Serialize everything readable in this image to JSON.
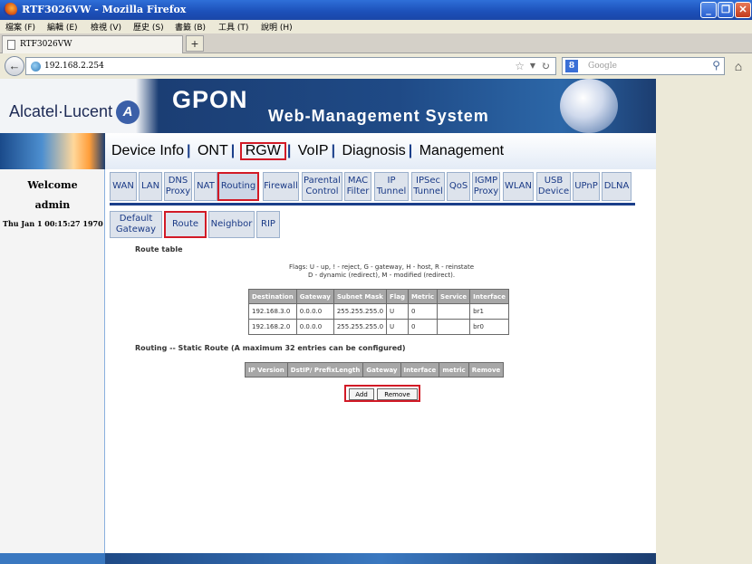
{
  "window": {
    "title": "RTF3026VW - Mozilla Firefox",
    "controls": [
      "_",
      "❐",
      "✕"
    ]
  },
  "menubar": [
    "檔案 (F)",
    "編輯 (E)",
    "檢視 (V)",
    "歷史 (S)",
    "書籤 (B)",
    "工具 (T)",
    "說明 (H)"
  ],
  "tabs": [
    {
      "label": "RTF3026VW"
    }
  ],
  "newtab": "+",
  "navbar": {
    "url": "192.168.2.254",
    "search_placeholder": "Google",
    "search_engine": "8"
  },
  "banner": {
    "brand": "Alcatel·Lucent",
    "brand_mark": "A",
    "product": "GPON",
    "subtitle": "Web-Management System"
  },
  "left": {
    "welcome": "Welcome",
    "user": "admin",
    "clock": "Thu Jan 1 00:15:27 1970"
  },
  "topnav": [
    "Device Info",
    "ONT",
    "RGW",
    "VoIP",
    "Diagnosis",
    "Management"
  ],
  "topnav_active": "RGW",
  "subnav": [
    "WAN",
    "LAN",
    "DNS Proxy",
    "NAT",
    "Routing",
    "Firewall",
    "Parental Control",
    "MAC Filter",
    "IP Tunnel",
    "IPSec Tunnel",
    "QoS",
    "IGMP Proxy",
    "WLAN",
    "USB Device",
    "UPnP",
    "DLNA"
  ],
  "subnav_active": "Routing",
  "routing_tabs": [
    "Default Gateway",
    "Route",
    "Neighbor",
    "RIP"
  ],
  "routing_active": "Route",
  "route_table": {
    "title": "Route table",
    "flags_line1": "Flags: U - up, ! - reject, G - gateway, H - host, R - reinstate",
    "flags_line2": "D - dynamic (redirect), M - modified (redirect).",
    "columns": [
      "Destination",
      "Gateway",
      "Subnet Mask",
      "Flag",
      "Metric",
      "Service",
      "Interface"
    ],
    "rows": [
      [
        "192.168.3.0",
        "0.0.0.0",
        "255.255.255.0",
        "U",
        "0",
        "",
        "br1"
      ],
      [
        "192.168.2.0",
        "0.0.0.0",
        "255.255.255.0",
        "U",
        "0",
        "",
        "br0"
      ]
    ]
  },
  "static_route": {
    "title": "Routing -- Static Route (A maximum 32 entries can be configured)",
    "columns": [
      "IP Version",
      "DstIP/ PrefixLength",
      "Gateway",
      "Interface",
      "metric",
      "Remove"
    ],
    "add_label": "Add",
    "remove_label": "Remove"
  },
  "colors": {
    "highlight": "#d21a26",
    "nav_blue": "#1b3f8a",
    "tab_bg": "#dde3ec"
  }
}
